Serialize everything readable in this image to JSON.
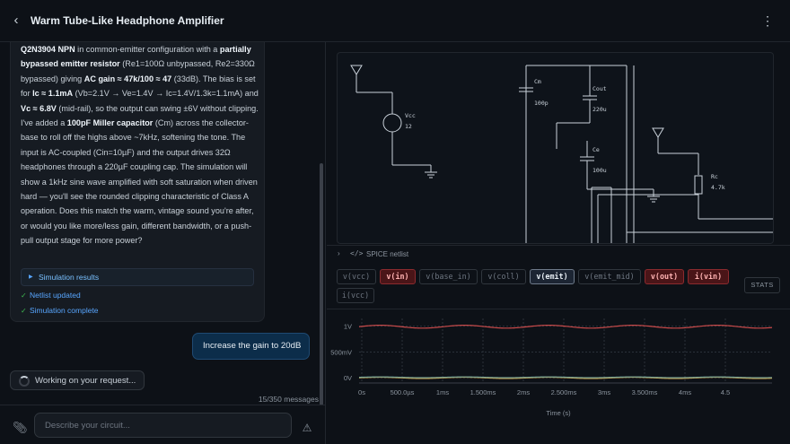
{
  "header": {
    "title": "Warm Tube-Like Headphone Amplifier",
    "back_icon": "chevron-left-icon",
    "menu_icon": "kebab-icon"
  },
  "chat": {
    "ai_message": [
      [
        {
          "b": "Q2N3904 NPN"
        },
        {
          "t": " in common-emitter configuration with a "
        },
        {
          "b": "partially bypassed emitter resistor"
        },
        {
          "t": " (Re1=100Ω unbypassed, Re2=330Ω bypassed) giving "
        },
        {
          "b": "AC gain ≈ 47k/100 ≈ 47"
        },
        {
          "t": " (33dB). The bias is set for "
        },
        {
          "b": "Ic ≈ 1.1mA"
        },
        {
          "t": " (Vb=2.1V → Ve=1.4V → Ic=1.4V/1.3k=1.1mA) and "
        },
        {
          "b": "Vc ≈ 6.8V"
        },
        {
          "t": " (mid-rail), so the output can swing ±6V without clipping. I've added a "
        },
        {
          "b": "100pF Miller capacitor"
        },
        {
          "t": " (Cm) across the collector-base to roll off the highs above ~7kHz, softening the tone. The input is AC-coupled (Cin=10µF) and the output drives 32Ω headphones through a 220µF coupling cap. The simulation will show a 1kHz sine wave amplified with soft saturation when driven hard — you'll see the rounded clipping characteristic of Class A operation. Does this match the warm, vintage sound you're after, or would you like more/less gain, different bandwidth, or a push-pull output stage for more power?"
        }
      ]
    ],
    "sim_results_label": "Simulation results",
    "status_items": [
      "Netlist updated",
      "Simulation complete"
    ],
    "user_message": "Increase the gain to 20dB",
    "working_label": "Working on your request...",
    "message_count": "15/350 messages",
    "input_placeholder": "Describe your circuit..."
  },
  "schematic": {
    "labels": {
      "vcc": "Vcc",
      "vcc_val": "12",
      "cm": "Cm",
      "cm_val": "100p",
      "cout": "Cout",
      "cout_val": "220u",
      "ce": "Ce",
      "ce_val": "100u",
      "rc": "Rc",
      "rc_val": "4.7k"
    }
  },
  "netlist": {
    "label": "SPICE netlist"
  },
  "signals": [
    {
      "label": "v(vcc)",
      "state": "off"
    },
    {
      "label": "v(in)",
      "state": "red"
    },
    {
      "label": "v(base_in)",
      "state": "off"
    },
    {
      "label": "v(coll)",
      "state": "off"
    },
    {
      "label": "v(emit)",
      "state": "blue"
    },
    {
      "label": "v(emit_mid)",
      "state": "off"
    },
    {
      "label": "v(out)",
      "state": "red"
    },
    {
      "label": "i(vin)",
      "state": "red"
    },
    {
      "label": "i(vcc)",
      "state": "off"
    }
  ],
  "stats_label": "STATS",
  "chart_data": {
    "type": "line",
    "xlabel": "Time (s)",
    "ylabel": "",
    "x_ticks": [
      "0s",
      "500.0µs",
      "1ms",
      "1.500ms",
      "2ms",
      "2.500ms",
      "3ms",
      "3.500ms",
      "4ms",
      "4.5"
    ],
    "y_ticks": [
      "1V",
      "500mV",
      "0V"
    ],
    "xlim": [
      0,
      0.0049
    ],
    "ylim": [
      -0.1,
      1.15
    ],
    "series": [
      {
        "color": "#c94a4a",
        "kind": "sine",
        "offset": 0.99,
        "amplitude": 0.028,
        "freq_hz": 1000
      },
      {
        "color": "#d9a441",
        "kind": "sine",
        "offset": 0.0,
        "amplitude": 0.012,
        "freq_hz": 1000
      },
      {
        "color": "#7aa89a",
        "kind": "sine",
        "offset": 0.01,
        "amplitude": 0.008,
        "freq_hz": 1000
      }
    ],
    "grid": true
  }
}
